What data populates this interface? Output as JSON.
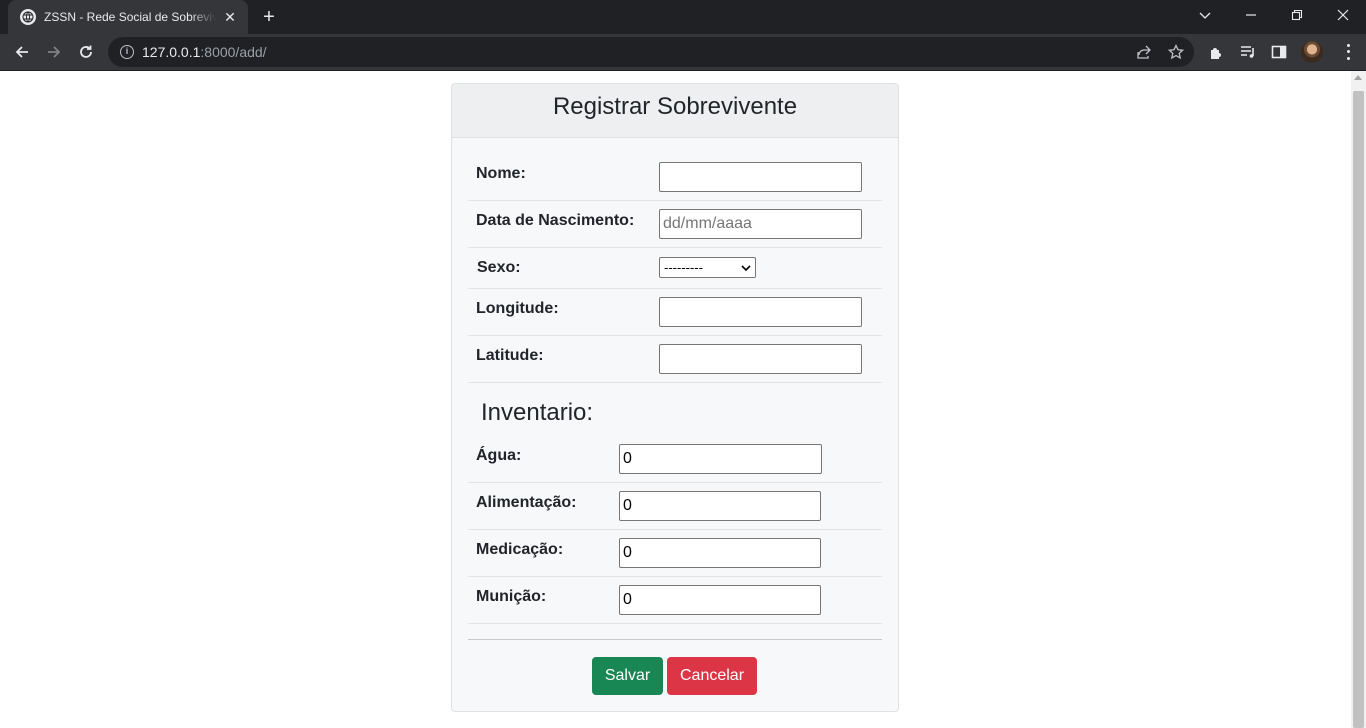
{
  "browser": {
    "tab_title": "ZSSN - Rede Social de Sobreviventes",
    "url_host": "127.0.0.1",
    "url_path": ":8000/add/"
  },
  "form": {
    "title": "Registrar Sobrevivente",
    "fields": {
      "nome": {
        "label": "Nome:",
        "value": ""
      },
      "nascimento": {
        "label": "Data de Nascimento:",
        "placeholder": "dd/mm/aaaa"
      },
      "sexo": {
        "label": "Sexo:",
        "selected": "---------"
      },
      "longitude": {
        "label": "Longitude:",
        "value": ""
      },
      "latitude": {
        "label": "Latitude:",
        "value": ""
      }
    },
    "inventory": {
      "title": "Inventario:",
      "agua": {
        "label": "Água:",
        "value": "0"
      },
      "alimentacao": {
        "label": "Alimentação:",
        "value": "0"
      },
      "medicacao": {
        "label": "Medicação:",
        "value": "0"
      },
      "municao": {
        "label": "Munição:",
        "value": "0"
      }
    },
    "buttons": {
      "save": "Salvar",
      "cancel": "Cancelar"
    }
  },
  "colors": {
    "save": "#198754",
    "cancel": "#dc3545"
  }
}
